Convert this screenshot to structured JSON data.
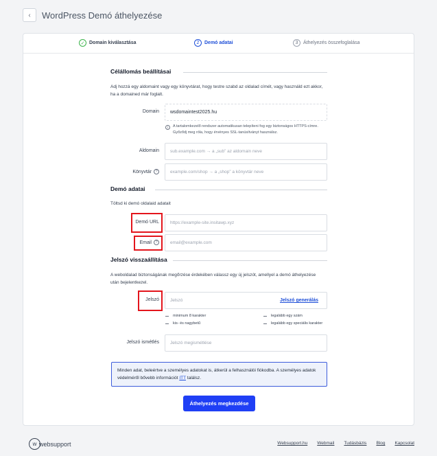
{
  "header": {
    "back_icon": "chevron-left-icon",
    "title": "WordPress Demó áthelyezése"
  },
  "steps": [
    {
      "label": "Domain kiválasztása",
      "marker": "✓",
      "state": "done"
    },
    {
      "label": "Demó adatai",
      "marker": "2",
      "state": "active"
    },
    {
      "label": "Áthelyezés összefoglalása",
      "marker": "3",
      "state": "inactive"
    }
  ],
  "target": {
    "title": "Célállomás beállításai",
    "description": "Adj hozzá egy aldomaint vagy egy könyvtárat, hogy testre szabd az oldalad címét, vagy használd ezt akkor, ha a domained már foglalt.",
    "domain_label": "Domain",
    "domain_value": "wsdomaintest2025.hu",
    "domain_note": "A tartalomkezelő rendszer automatikusan telepíteni fog egy biztonságos HTTPS-címre. Győződj meg róla, hogy érvényes SSL-tanúsítványt használsz.",
    "subdomain_label": "Aldomain",
    "subdomain_placeholder": "sub.example.com → a „sub” az aldomain neve",
    "directory_label": "Könyvtár",
    "directory_placeholder": "example.com/shop → a „shop” a könyvtár neve"
  },
  "demo": {
    "title": "Demó adatai",
    "description": "Töltsd ki demó oldalaid adatait",
    "url_label": "Demó URL",
    "url_placeholder": "https://example-site.insitawp.xyz",
    "email_label": "Email",
    "email_placeholder": "email@example.com"
  },
  "password": {
    "title": "Jelszó visszaállítása",
    "description": "A weboldalad biztonságának megőrzése érdekében válassz egy új jelszót, amellyel a demó áthelyezése után bejelentkezel.",
    "label": "Jelszó",
    "placeholder": "Jelszó",
    "generate_link": "Jelszó generálás",
    "requirements": [
      "minimum 8 karakter",
      "legalább egy szám",
      "kis- és nagybetű",
      "legalább egy speciális karakter"
    ],
    "repeat_label": "Jelszó ismétlés",
    "repeat_placeholder": "Jelszó megismétlése"
  },
  "info": {
    "text_before": "Minden adat, beleértve a személyes adatokat is, átkerül a felhasználói fiókodba. A személyes adatok védelméről bővebb információt ",
    "link": "ITT",
    "text_after": " találsz."
  },
  "submit_label": "Áthelyezés megkezdése",
  "footer": {
    "logo_text": "websupport",
    "links": [
      "Websupport.hu",
      "Webmail",
      "Tudásbázis",
      "Blog",
      "Kapcsolat"
    ]
  },
  "colors": {
    "accent": "#1f3ff5",
    "success": "#3bb34a",
    "highlight": "#e3141b"
  }
}
